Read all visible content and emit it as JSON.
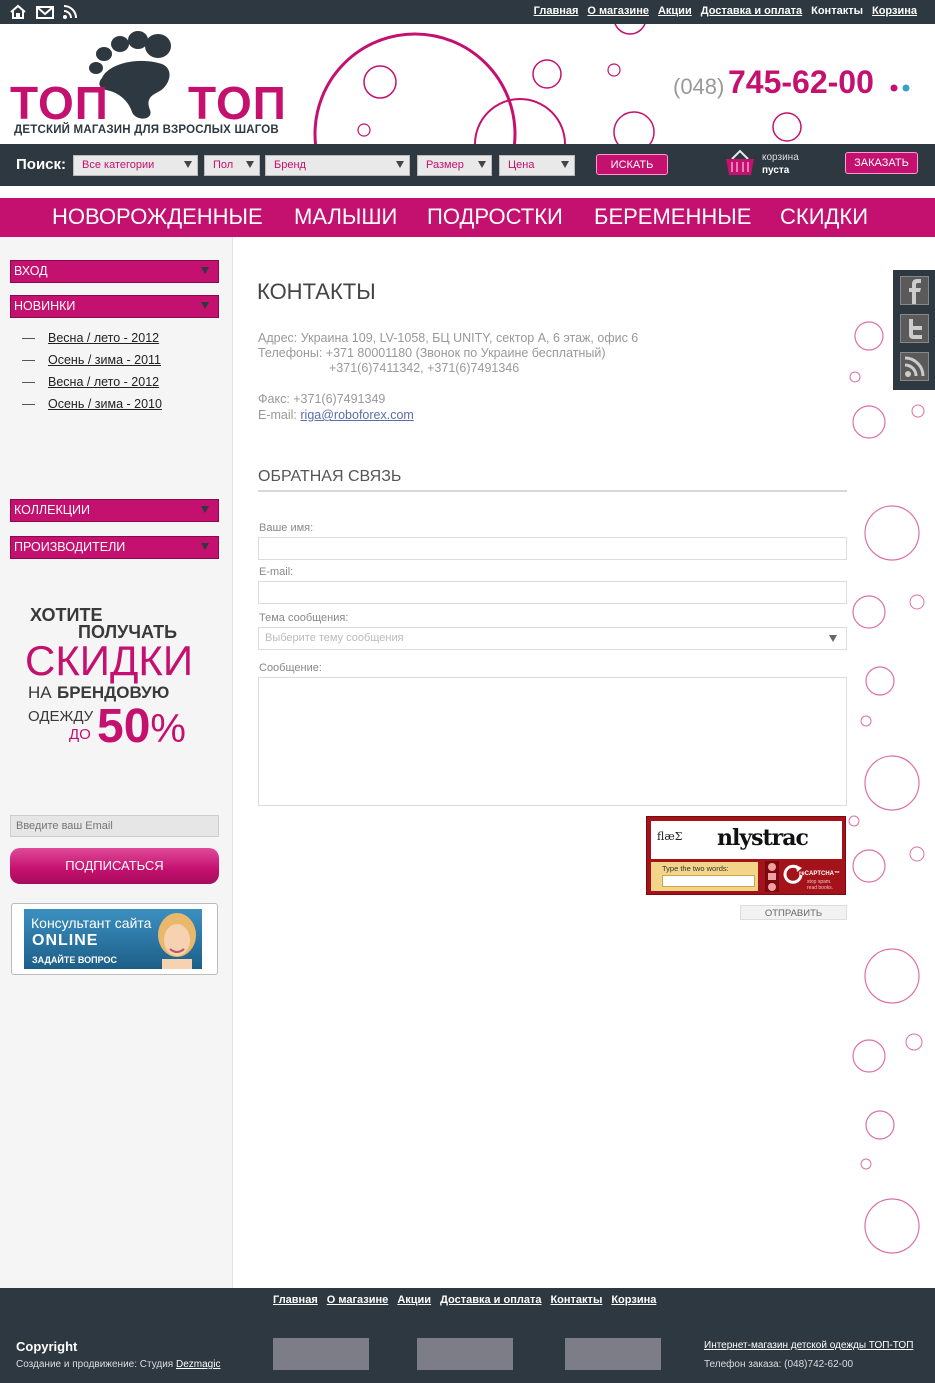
{
  "top_nav": [
    "Главная",
    "О магазине",
    "Акции",
    "Доставка и оплата",
    "Контакты",
    "Корзина"
  ],
  "logo": {
    "word_left": "ТОП",
    "word_right": "ТОП",
    "tagline": "ДЕТСКИЙ МАГАЗИН ДЛЯ ВЗРОСЛЫХ ШАГОВ"
  },
  "phone": {
    "prefix": "(048)",
    "number": "745-62-00"
  },
  "search": {
    "label": "Поиск:",
    "filters": [
      "Все категории",
      "Пол",
      "Бренд",
      "Размер",
      "Цена"
    ],
    "button": "ИСКАТЬ"
  },
  "cart": {
    "title": "корзина",
    "status": "пуста",
    "order_button": "ЗАКАЗАТЬ"
  },
  "main_nav": [
    "НОВОРОЖДЕННЫЕ",
    "МАЛЫШИ",
    "ПОДРОСТКИ",
    "БЕРЕМЕННЫЕ",
    "СКИДКИ"
  ],
  "sidebar": {
    "login": "ВХОД",
    "new": "НОВИНКИ",
    "new_items": [
      "Весна / лето - 2012",
      "Осень / зима - 2011",
      "Весна / лето - 2012",
      "Осень / зима - 2010"
    ],
    "collections": "КОЛЛЕКЦИИ",
    "manufacturers": "ПРОИЗВОДИТЕЛИ",
    "promo": {
      "l1": "ХОТИТЕ",
      "l2": "ПОЛУЧАТЬ",
      "l3": "СКИДКИ",
      "l4a": "НА",
      "l4b": "БРЕНДОВУЮ",
      "l5": "ОДЕЖДУ",
      "l6": "ДО",
      "pct": "50",
      "pct_sign": "%"
    },
    "email_placeholder": "Введите ваш Email",
    "subscribe": "ПОДПИСАТЬСЯ",
    "consultant": {
      "l1": "Консультант сайта",
      "l2": "ONLINE",
      "l3": "ЗАДАЙТЕ ВОПРОС"
    }
  },
  "social": [
    "facebook",
    "twitter",
    "rss"
  ],
  "content": {
    "title": "КОНТАКТЫ",
    "address": "Адрес: Украина 109, LV-1058, БЦ UNITY, сектор А, 6 этаж, офис 6",
    "phones": "Телефоны: +371 80001180 (Звонок по Украине бесплатный)",
    "phones2": "+371(6)7411342, +371(6)7491346",
    "fax": "Факс: +371(6)7491349",
    "email_label": "E-mail:",
    "email": "riga@roboforex.com",
    "feedback_title": "ОБРАТНАЯ СВЯЗЬ",
    "form": {
      "name_label": "Ваше имя:",
      "email_label": "E-mail:",
      "subject_label": "Тема сообщения:",
      "subject_placeholder": "Выберите тему сообщения",
      "message_label": "Сообщение:",
      "send": "ОТПРАВИТЬ"
    },
    "captcha": {
      "word1": "flæƩ",
      "word2": "nlystrac",
      "prompt": "Type the two words:",
      "brand": "reCAPTCHA™",
      "tagline1": "stop spam.",
      "tagline2": "read books."
    }
  },
  "footer": {
    "nav": [
      "Главная",
      "О магазине",
      "Акции",
      "Доставка и оплата",
      "Контакты",
      "Корзина"
    ],
    "copyright": "Copyright",
    "credit_prefix": "Создание и продвижение: Студия",
    "credit_link": "Dezmagic",
    "shop_link": "Интернет-магазин детской одежды ТОП-ТОП",
    "order_phone": "Телефон заказа: (048)742-62-00"
  },
  "colors": {
    "brand": "#c4106e",
    "dark": "#2e3840",
    "sidebar_bg": "#f5f5f5"
  }
}
